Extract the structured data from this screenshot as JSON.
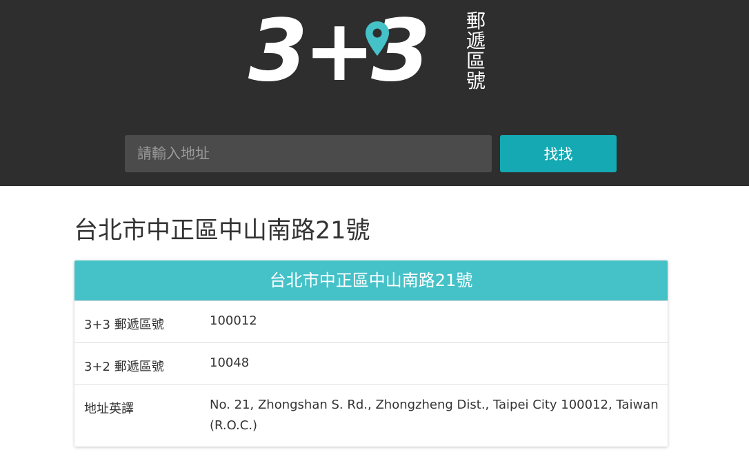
{
  "header": {
    "logo": {
      "main_text": "3+3",
      "sub_text": "郵遞區號",
      "pin_color": "#45c1c8"
    },
    "search": {
      "placeholder": "請輸入地址",
      "value": "",
      "button_label": "找找"
    },
    "background_color": "#2e2e2e"
  },
  "main": {
    "title": "台北市中正區中山南路21號",
    "result_card": {
      "header": "台北市中正區中山南路21號",
      "header_color": "#45c1c8",
      "rows": [
        {
          "label": "3+3 郵遞區號",
          "value": "100012"
        },
        {
          "label": "3+2 郵遞區號",
          "value": "10048"
        },
        {
          "label": "地址英譯",
          "value": "No. 21, Zhongshan S. Rd., Zhongzheng Dist., Taipei City 100012, Taiwan (R.O.C.)"
        }
      ]
    }
  },
  "colors": {
    "accent": "#14a9b3",
    "card_header": "#45c1c8"
  }
}
